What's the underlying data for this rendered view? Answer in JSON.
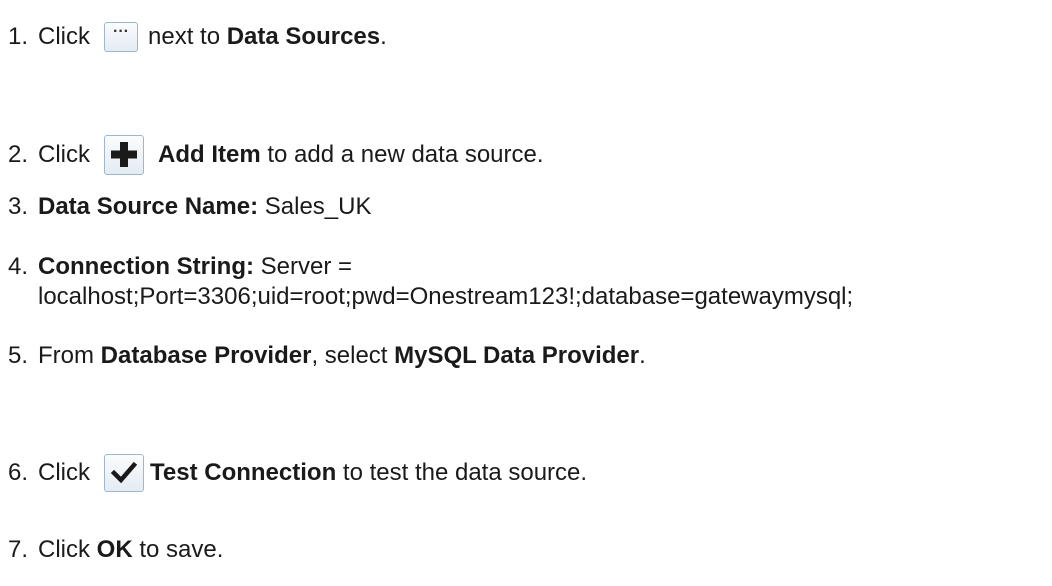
{
  "steps": [
    {
      "num": "1.",
      "a": "Click",
      "b": "next to",
      "c": "Data Sources",
      "d": "."
    },
    {
      "num": "2.",
      "a": "Click",
      "b": "Add Item",
      "c": "to add a new data source."
    },
    {
      "num": "3.",
      "a": "Data Source Name:",
      "b": "Sales_UK"
    },
    {
      "num": "4.",
      "a": "Connection String:",
      "b": "Server =",
      "c": "localhost;Port=3306;uid=root;pwd=Onestream123!;database=gatewaymysql;"
    },
    {
      "num": "5.",
      "a": "From",
      "b": "Database Provider",
      "c": ", select",
      "d": "MySQL Data Provider",
      "e": "."
    },
    {
      "num": "6.",
      "a": "Click",
      "b": "Test Connection",
      "c": "to test the data source."
    },
    {
      "num": "7.",
      "a": "Click",
      "b": "OK",
      "c": "to save."
    }
  ],
  "icons": {
    "ellipsis": "ellipsis-button-icon",
    "add": "plus-icon",
    "test": "checkmark-icon"
  },
  "ellipsis_glyph": "···"
}
